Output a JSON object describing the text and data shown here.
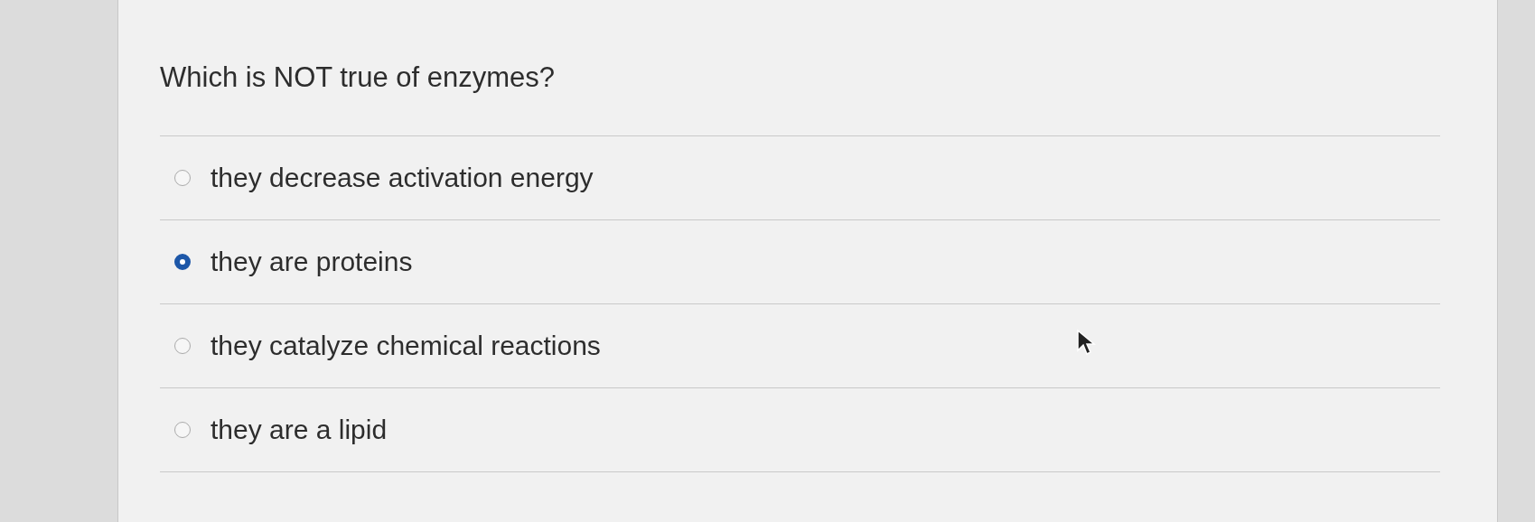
{
  "question": "Which is NOT true of enzymes?",
  "options": [
    {
      "label": "they decrease activation energy",
      "selected": false
    },
    {
      "label": "they are proteins",
      "selected": true
    },
    {
      "label": "they catalyze chemical reactions",
      "selected": false
    },
    {
      "label": "they are a lipid",
      "selected": false
    }
  ]
}
